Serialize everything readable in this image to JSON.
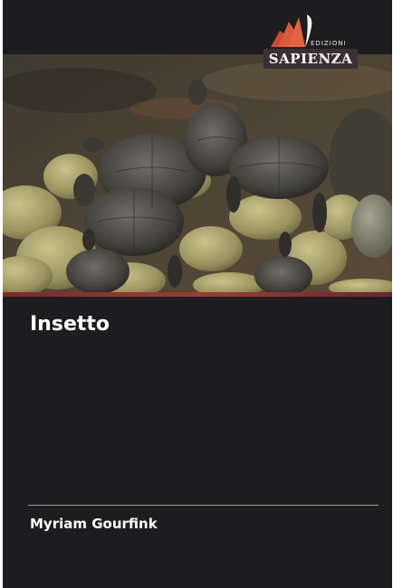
{
  "publisher": {
    "imprint": "EDIZIONI",
    "name": "SAPIENZA"
  },
  "book": {
    "title": "Insetto",
    "author": "Myriam Gourfink"
  },
  "colors": {
    "background": "#1d1d1f",
    "accent_band": "#a23a32",
    "logo_plate": "#3a2f35",
    "logo_fan": "#c94a3a"
  }
}
